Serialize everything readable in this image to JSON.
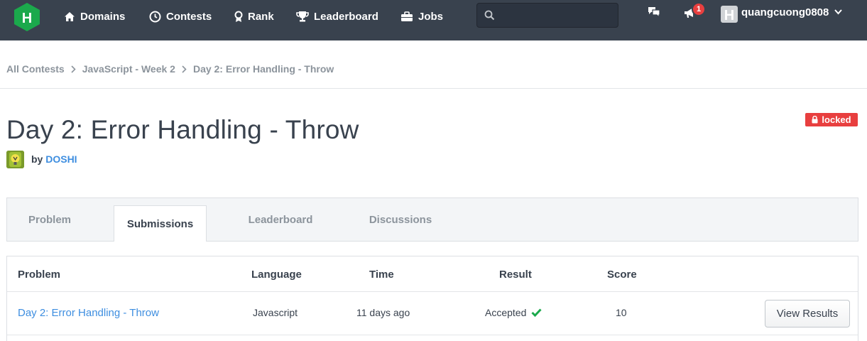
{
  "nav": {
    "items": [
      {
        "label": "Domains",
        "icon": "home-icon"
      },
      {
        "label": "Contests",
        "icon": "clock-icon"
      },
      {
        "label": "Rank",
        "icon": "medal-icon"
      },
      {
        "label": "Leaderboard",
        "icon": "trophy-icon"
      },
      {
        "label": "Jobs",
        "icon": "briefcase-icon"
      }
    ],
    "search_placeholder": "",
    "notification_count": "1",
    "username": "quangcuong0808"
  },
  "breadcrumb": [
    "All Contests",
    "JavaScript - Week 2",
    "Day 2: Error Handling - Throw"
  ],
  "challenge": {
    "title": "Day 2: Error Handling - Throw",
    "status": "locked",
    "by_label": "by",
    "author": "DOSHI"
  },
  "tabs": [
    {
      "label": "Problem",
      "active": false
    },
    {
      "label": "Submissions",
      "active": true
    },
    {
      "label": "Leaderboard",
      "active": false
    },
    {
      "label": "Discussions",
      "active": false
    }
  ],
  "submissions": {
    "headers": [
      "Problem",
      "Language",
      "Time",
      "Result",
      "Score"
    ],
    "rows": [
      {
        "problem": "Day 2: Error Handling - Throw",
        "language": "Javascript",
        "time": "11 days ago",
        "result": "Accepted",
        "score": "10",
        "action": "View Results"
      }
    ]
  },
  "colors": {
    "nav_bg": "#39424e",
    "logo_green": "#1ba94c",
    "link": "#3e8ee0",
    "locked": "#e83f3f",
    "accepted": "#1ba94c"
  }
}
